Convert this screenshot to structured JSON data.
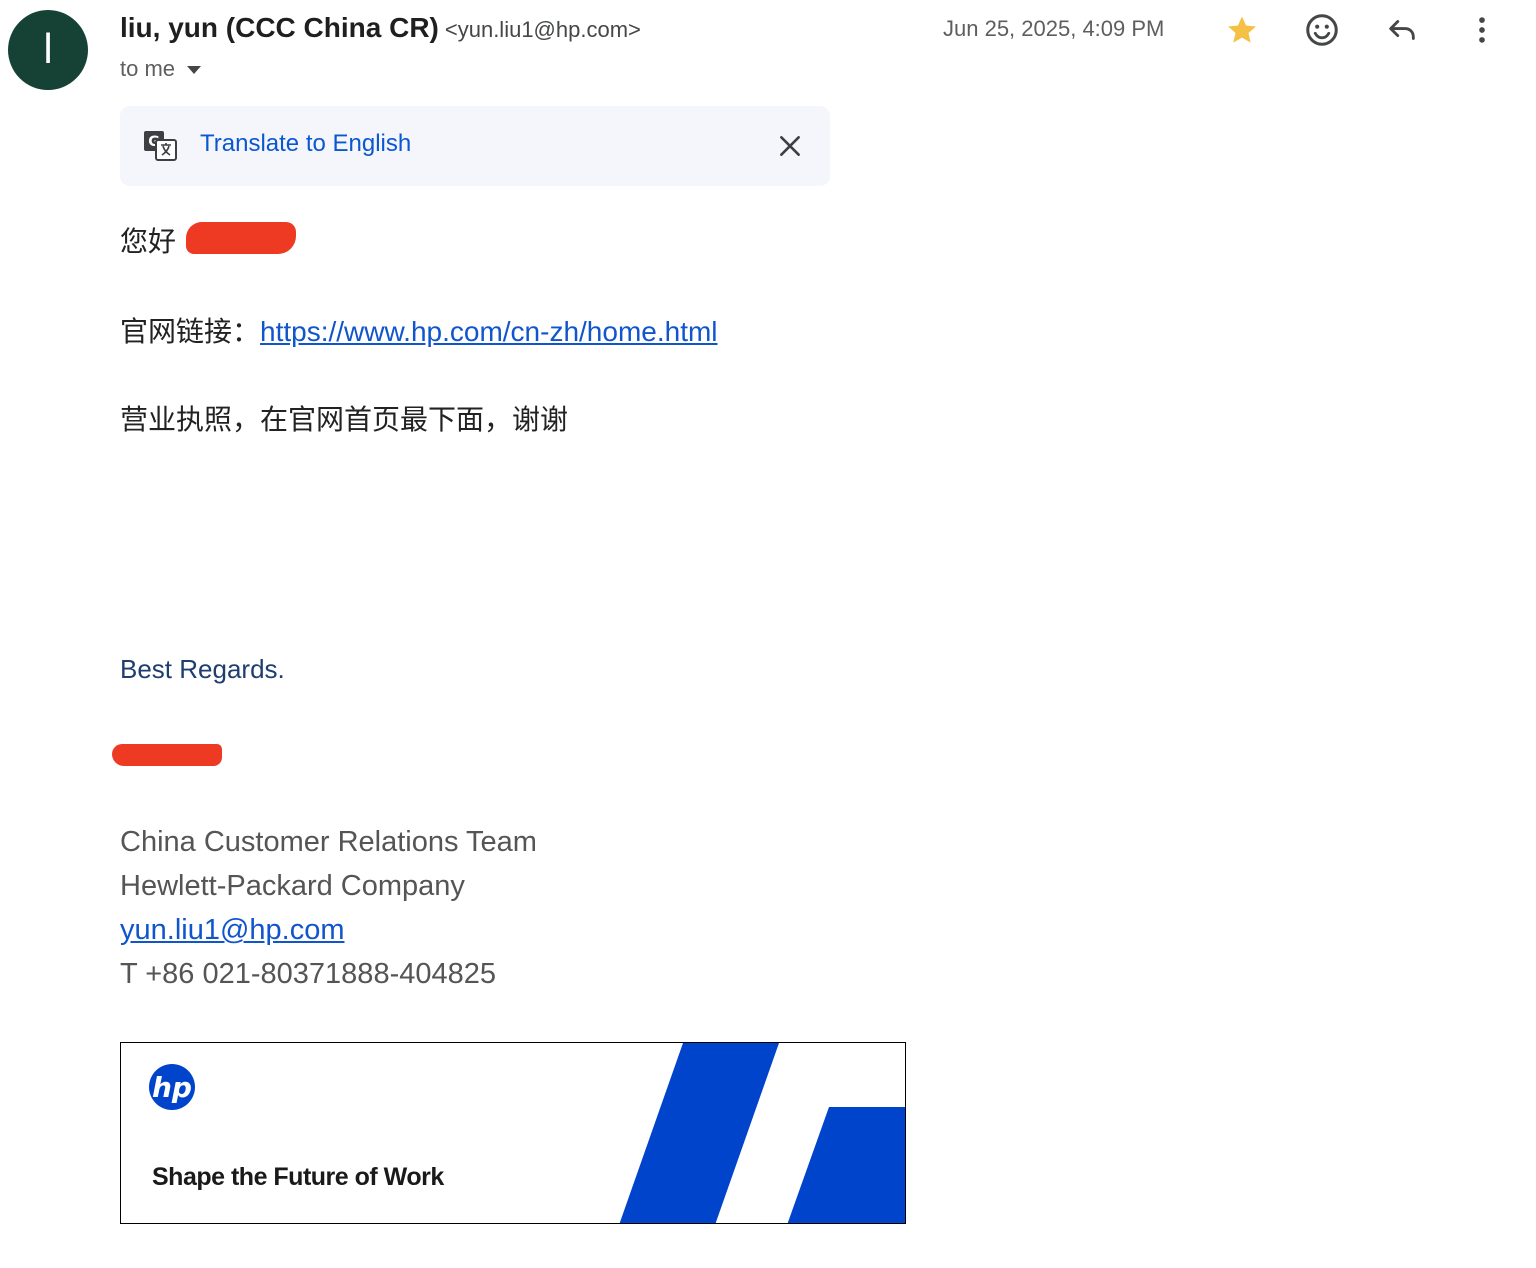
{
  "sender": {
    "avatar_initial": "l",
    "name": "liu, yun (CCC China CR)",
    "email": "<yun.liu1@hp.com>",
    "recipient": "to me",
    "timestamp": "Jun 25, 2025, 4:09 PM"
  },
  "actions": {
    "star_icon": "star-icon",
    "emoji_icon": "emoji-icon",
    "reply_icon": "reply-icon",
    "more_icon": "more-vert-icon",
    "star_color": "#f4c146"
  },
  "translate": {
    "label": "Translate to English"
  },
  "message": {
    "greeting": "您好",
    "link_label": "官网链接：",
    "link_url": "https://www.hp.com/cn-zh/home.html",
    "license_text": "营业执照，在官网首页最下面，谢谢"
  },
  "signature": {
    "regards": "Best Regards.",
    "team": "China Customer Relations Team",
    "company": "Hewlett-Packard Company",
    "email": "yun.liu1@hp.com",
    "phone": "T +86 021-80371888-404825"
  },
  "banner": {
    "tagline": "Shape the Future of Work",
    "brand_color": "#0044cc"
  }
}
